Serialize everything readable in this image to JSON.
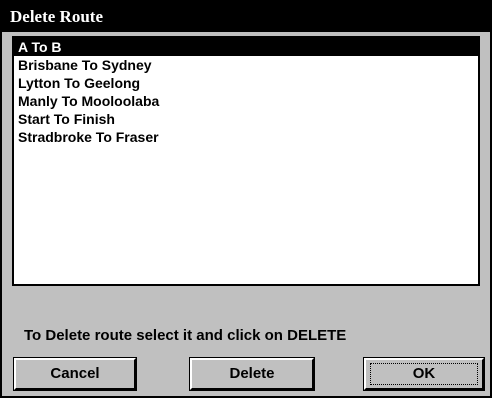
{
  "dialog": {
    "title": "Delete Route"
  },
  "routes": {
    "items": [
      {
        "label": "A To B",
        "selected": true
      },
      {
        "label": "Brisbane To Sydney",
        "selected": false
      },
      {
        "label": "Lytton To Geelong",
        "selected": false
      },
      {
        "label": "Manly To Mooloolaba",
        "selected": false
      },
      {
        "label": "Start To Finish",
        "selected": false
      },
      {
        "label": "Stradbroke To Fraser",
        "selected": false
      }
    ]
  },
  "instruction": "To Delete route select it and click on DELETE",
  "buttons": {
    "cancel": "Cancel",
    "delete": "Delete",
    "ok": "OK"
  },
  "colors": {
    "titlebar": "#000000",
    "dialog_bg": "#c0c0c0",
    "selection": "#000000"
  }
}
